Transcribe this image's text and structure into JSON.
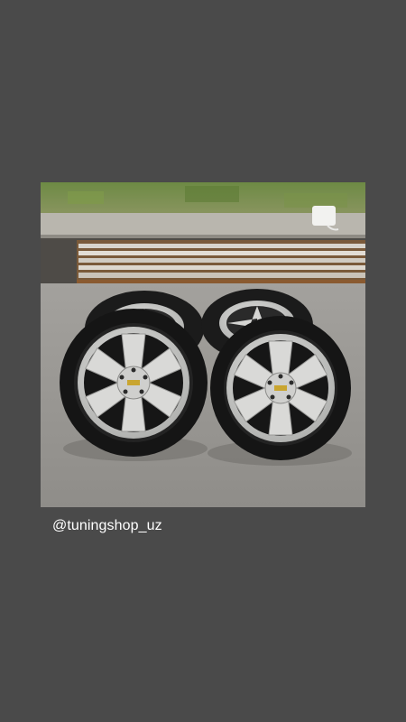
{
  "story": {
    "background_color": "#4a4a4a",
    "handle_text": "@tuningshop_uz",
    "photo": {
      "subject": "four-alloy-wheels-on-pavement",
      "wheel_count": 4
    }
  }
}
